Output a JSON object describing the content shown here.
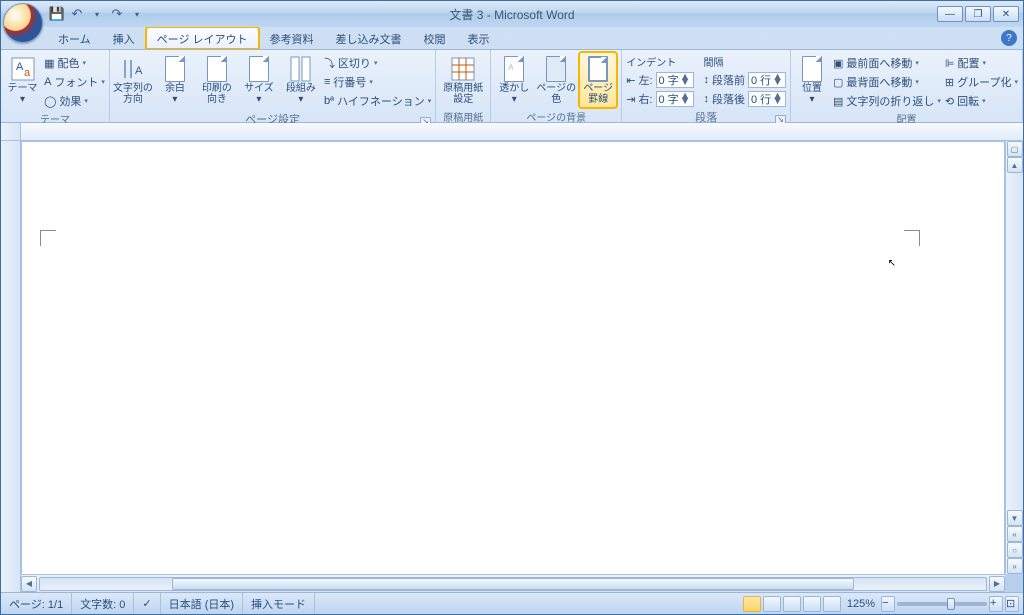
{
  "title": "文書 3 - Microsoft Word",
  "qat": {
    "save": "💾",
    "undo": "↶",
    "redo": "↷",
    "dd": "▾"
  },
  "tabs": [
    "ホーム",
    "挿入",
    "ページ レイアウト",
    "参考資料",
    "差し込み文書",
    "校閲",
    "表示"
  ],
  "active_tab_index": 2,
  "ribbon": {
    "theme": {
      "label": "テーマ",
      "btn": "テーマ",
      "colors": "配色",
      "fonts": "フォント",
      "effects": "効果"
    },
    "page_setup": {
      "label": "ページ設定",
      "text_dir": "文字列の\n方向",
      "margins": "余白",
      "orient": "印刷の\n向き",
      "size": "サイズ",
      "columns": "段組み",
      "breaks": "区切り",
      "line_num": "行番号",
      "hyphen": "ハイフネーション"
    },
    "genko": {
      "label": "原稿用紙",
      "btn": "原稿用紙\n設定"
    },
    "page_bg": {
      "label": "ページの背景",
      "watermark": "透かし",
      "pg_color": "ページの\n色",
      "borders": "ページ\n罫線"
    },
    "para": {
      "label": "段落",
      "indent_title": "インデント",
      "indent_left": "左:",
      "indent_left_val": "0 字",
      "indent_right": "右:",
      "indent_right_val": "0 字",
      "spacing_title": "間隔",
      "space_before": "段落前",
      "space_before_val": "0 行",
      "space_after": "段落後",
      "space_after_val": "0 行"
    },
    "arrange": {
      "label": "配置",
      "position": "位置",
      "front": "最前面へ移動",
      "back": "最背面へ移動",
      "wrap": "文字列の折り返し",
      "align": "配置",
      "group": "グループ化",
      "rotate": "回転"
    }
  },
  "status": {
    "page": "ページ: 1/1",
    "words": "文字数: 0",
    "lang": "日本語 (日本)",
    "mode": "挿入モード",
    "zoom": "125%"
  },
  "glyph": {
    "dd": "▾",
    "check": "✓",
    "plus": "+",
    "minus": "−",
    "up": "▲",
    "down": "▼",
    "left": "◀",
    "right": "▶",
    "split": "≡"
  }
}
